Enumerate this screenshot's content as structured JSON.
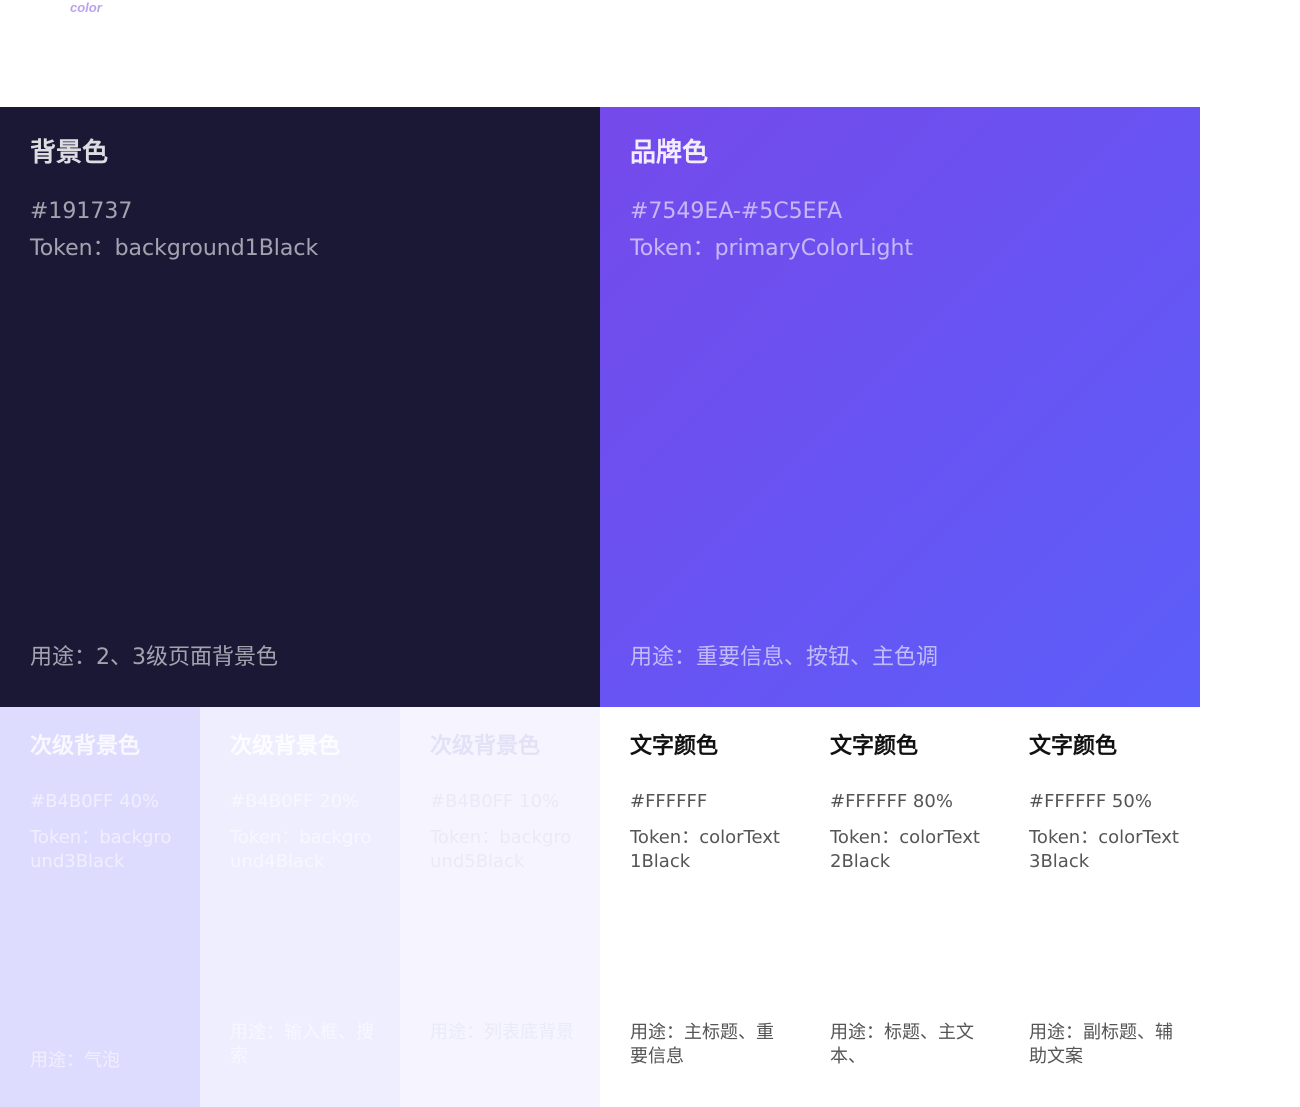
{
  "header": {
    "logo_text": "color"
  },
  "swatches": {
    "background": {
      "title": "背景色",
      "hex": "#191737",
      "token": "Token：background1Black",
      "usage": "用途：2、3级页面背景色"
    },
    "brand": {
      "title": "品牌色",
      "hex": "#7549EA-#5C5EFA",
      "token": "Token：primaryColorLight",
      "usage": "用途：重要信息、按钮、主色调"
    },
    "secondary": [
      {
        "title": "次级背景色",
        "hex": "#B4B0FF 40%",
        "token": "Token：background3Black",
        "usage": "用途：气泡"
      },
      {
        "title": "次级背景色",
        "hex": "#B4B0FF 20%",
        "token": "Token：background4Black",
        "usage": "用途：输入框、搜索"
      },
      {
        "title": "次级背景色",
        "hex": "#B4B0FF 10%",
        "token": "Token：background5Black",
        "usage": "用途：列表底背景"
      }
    ],
    "text": [
      {
        "title": "文字颜色",
        "hex": "#FFFFFF",
        "token": "Token：colorText1Black",
        "usage": "用途：主标题、重要信息"
      },
      {
        "title": "文字颜色",
        "hex": "#FFFFFF 80%",
        "token": "Token：colorText2Black",
        "usage": "用途：标题、主文本、"
      },
      {
        "title": "文字颜色",
        "hex": "#FFFFFF 50%",
        "token": "Token：colorText3Black",
        "usage": "用途：副标题、辅助文案"
      }
    ]
  },
  "colors": {
    "background": "#191737",
    "brand_start": "#7549EA",
    "brand_end": "#5C5EFA",
    "secondary_base": "#B4B0FF"
  }
}
